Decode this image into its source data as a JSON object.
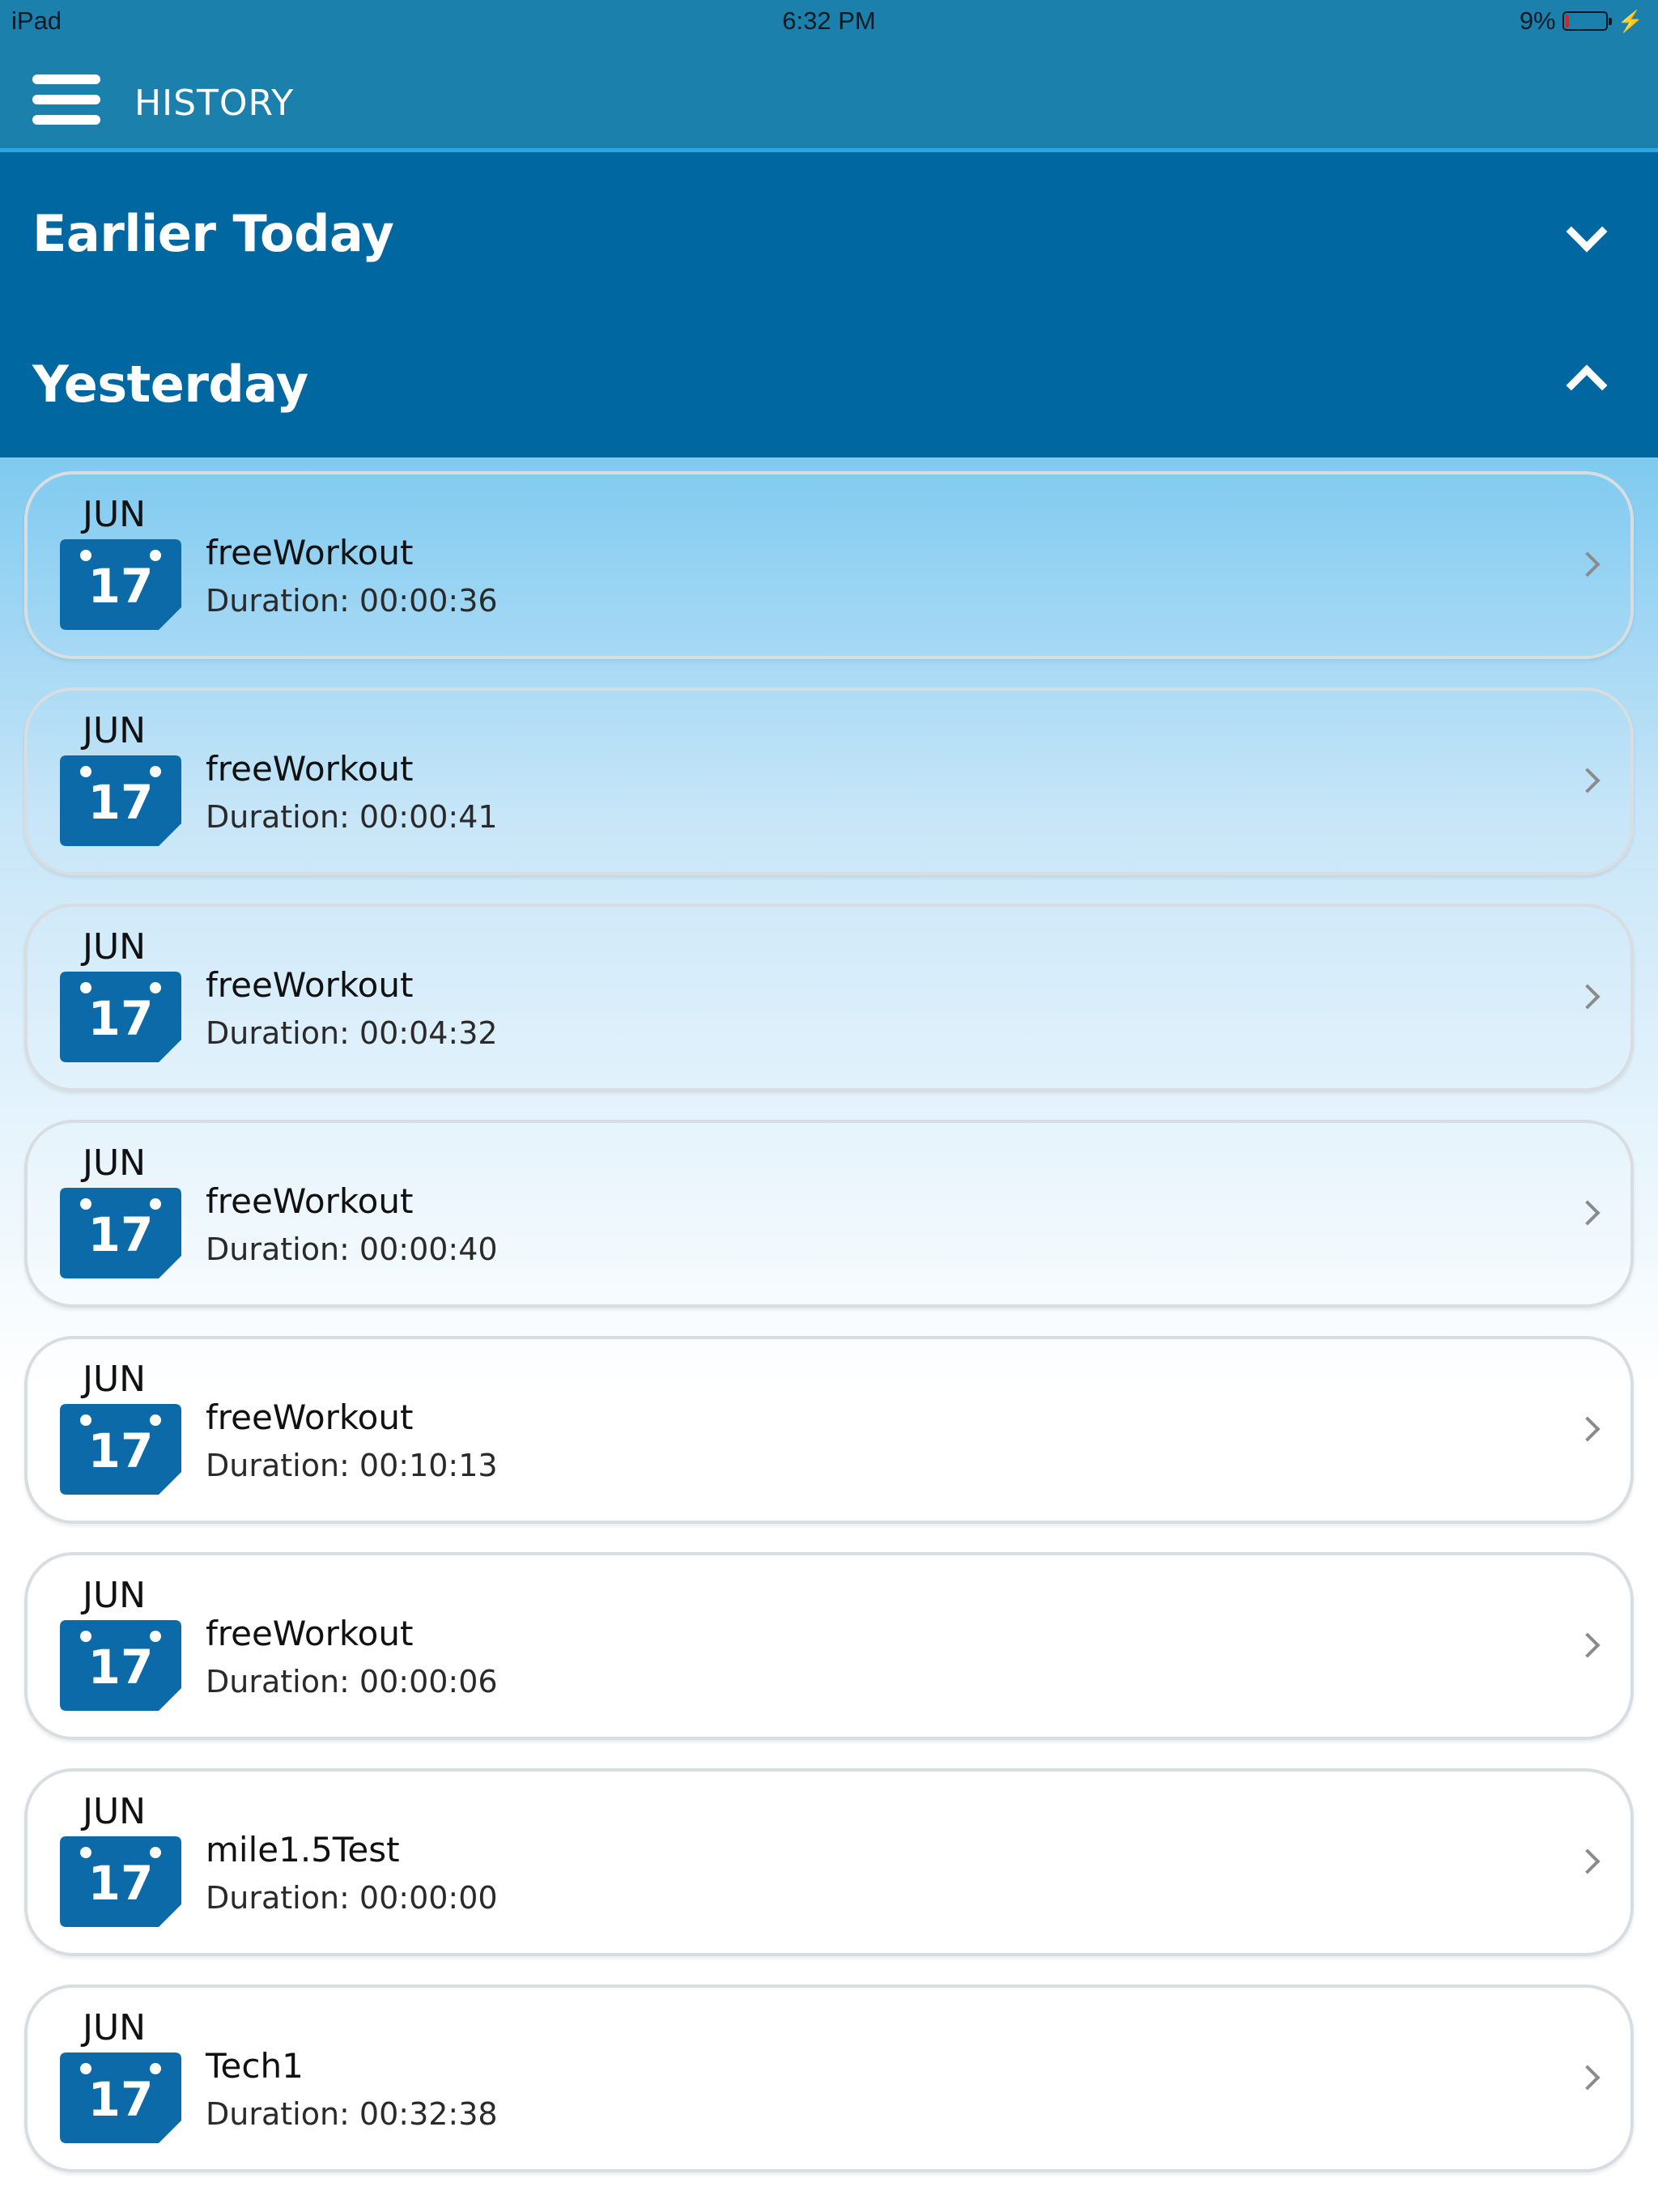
{
  "status_bar": {
    "carrier": "iPad",
    "time": "6:32 PM",
    "battery_percent": "9%",
    "battery_level": 0.09,
    "battery_color": "#e0201b",
    "charging_icon": "bolt-icon"
  },
  "app_bar": {
    "menu_icon": "hamburger-menu-icon",
    "title": "HISTORY"
  },
  "sections": [
    {
      "title": "Earlier Today",
      "expanded": false,
      "icon": "chevron-down-icon"
    },
    {
      "title": "Yesterday",
      "expanded": true,
      "icon": "chevron-up-icon"
    }
  ],
  "workouts": [
    {
      "month": "JUN",
      "day": "17",
      "name": "freeWorkout",
      "duration": "Duration: 00:00:36"
    },
    {
      "month": "JUN",
      "day": "17",
      "name": "freeWorkout",
      "duration": "Duration: 00:00:41"
    },
    {
      "month": "JUN",
      "day": "17",
      "name": "freeWorkout",
      "duration": "Duration: 00:04:32"
    },
    {
      "month": "JUN",
      "day": "17",
      "name": "freeWorkout",
      "duration": "Duration: 00:00:40"
    },
    {
      "month": "JUN",
      "day": "17",
      "name": "freeWorkout",
      "duration": "Duration: 00:10:13"
    },
    {
      "month": "JUN",
      "day": "17",
      "name": "freeWorkout",
      "duration": "Duration: 00:00:06"
    },
    {
      "month": "JUN",
      "day": "17",
      "name": "mile1.5Test",
      "duration": "Duration: 00:00:00"
    },
    {
      "month": "JUN",
      "day": "17",
      "name": "Tech1",
      "duration": "Duration: 00:32:38"
    }
  ],
  "colors": {
    "app_bar": "#1b80ab",
    "section_header": "#0067a0",
    "calendar_icon": "#0b6aa7",
    "accent_line": "#29a8e8"
  }
}
